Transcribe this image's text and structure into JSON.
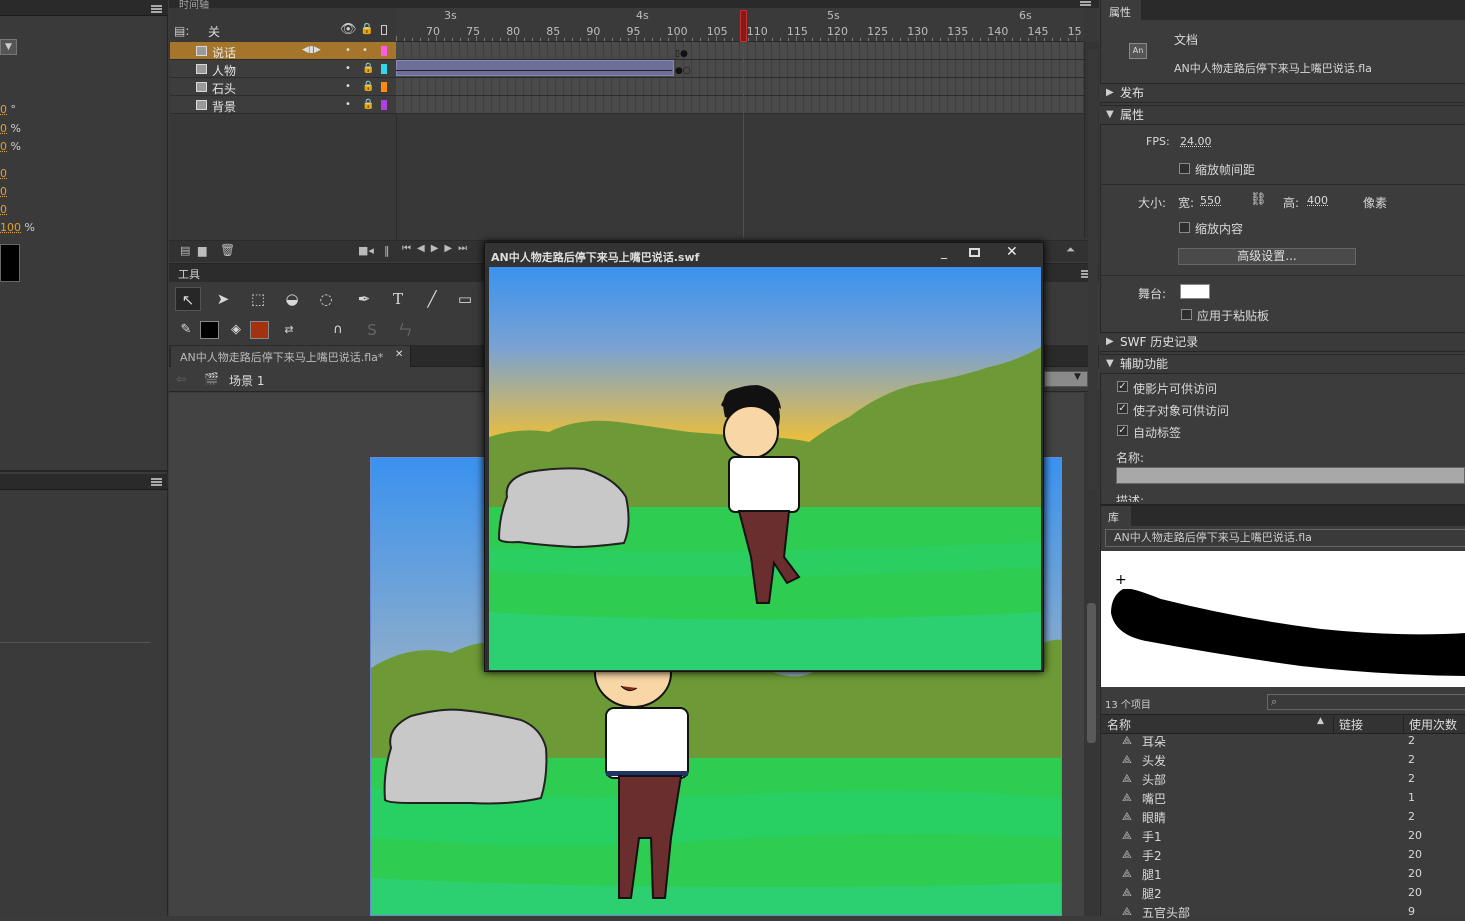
{
  "timeline": {
    "tab": "时间轴",
    "header_label": "关",
    "ticks": [
      "70",
      "75",
      "80",
      "85",
      "90",
      "95",
      "100",
      "105",
      "110",
      "115",
      "120",
      "125",
      "130",
      "135",
      "140",
      "145",
      "15"
    ],
    "seconds": [
      "3s",
      "4s",
      "5s",
      "6s"
    ],
    "layers": [
      {
        "name": "说话",
        "color": "#ff5ae6",
        "selected": true
      },
      {
        "name": "人物",
        "color": "#35d7ea",
        "selected": false
      },
      {
        "name": "石头",
        "color": "#ff8c10",
        "selected": false
      },
      {
        "name": "背景",
        "color": "#b040e0",
        "selected": false
      }
    ]
  },
  "tools": {
    "title": "工具"
  },
  "document_tab": {
    "label": "AN中人物走路后停下来马上嘴巴说话.fla*",
    "close": "✕"
  },
  "scene": {
    "label": "场景 1"
  },
  "left_panel": {
    "values": [
      "0",
      "0",
      "0",
      "0",
      "0",
      "0",
      "100"
    ],
    "units": [
      "°",
      "%",
      "%",
      "",
      "",
      "",
      "%"
    ]
  },
  "swf_window": {
    "title": "AN中人物走路后停下来马上嘴巴说话.swf"
  },
  "properties": {
    "tab": "属性",
    "doc_label": "文档",
    "doc_icon": "An",
    "filename": "AN中人物走路后停下来马上嘴巴说话.fla",
    "publish": "发布",
    "props": "属性",
    "fps_label": "FPS:",
    "fps": "24.00",
    "scale_spans": "缩放帧间距",
    "size_label": "大小:",
    "width_label": "宽:",
    "width": "550",
    "height_label": "高:",
    "height": "400",
    "unit": "像素",
    "scale_content": "缩放内容",
    "advanced": "高级设置...",
    "stage_label": "舞台:",
    "apply_paste": "应用于粘贴板",
    "swf_history": "SWF 历史记录",
    "accessibility": "辅助功能",
    "acc_movie": "使影片可供访问",
    "acc_children": "使子对象可供访问",
    "acc_auto": "自动标签",
    "name_label": "名称:",
    "desc_label": "描述:"
  },
  "library": {
    "tab": "库",
    "file": "AN中人物走路后停下来马上嘴巴说话.fla",
    "count": "13 个项目",
    "col_name": "名称",
    "col_link": "链接",
    "col_use": "使用次数",
    "items": [
      {
        "name": "耳朵",
        "uses": "2"
      },
      {
        "name": "头发",
        "uses": "2"
      },
      {
        "name": "头部",
        "uses": "2"
      },
      {
        "name": "嘴巴",
        "uses": "1"
      },
      {
        "name": "眼睛",
        "uses": "2"
      },
      {
        "name": "手1",
        "uses": "20"
      },
      {
        "name": "手2",
        "uses": "20"
      },
      {
        "name": "腿1",
        "uses": "20"
      },
      {
        "name": "腿2",
        "uses": "20"
      },
      {
        "name": "五官头部",
        "uses": "9"
      }
    ]
  }
}
